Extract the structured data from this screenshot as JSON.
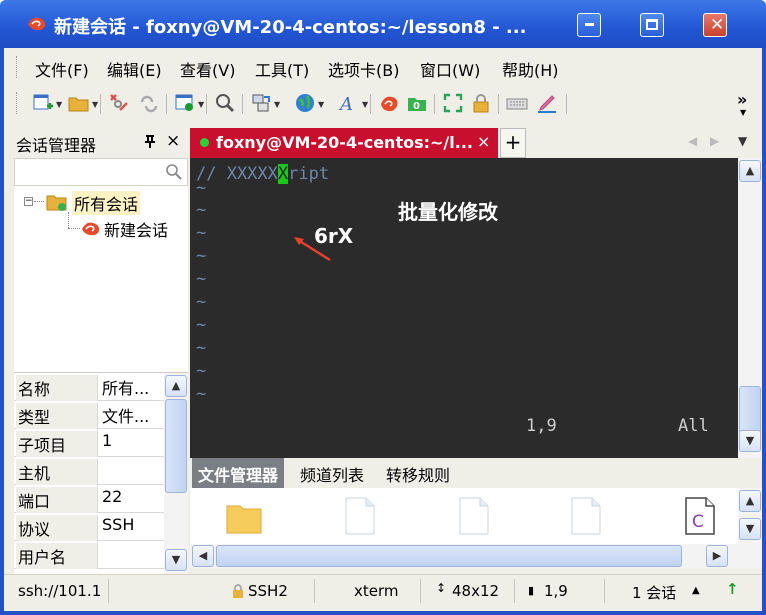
{
  "window": {
    "title": "新建会话 - foxny@VM-20-4-centos:~/lesson8 - ..."
  },
  "menu": [
    "文件(F)",
    "编辑(E)",
    "查看(V)",
    "工具(T)",
    "选项卡(B)",
    "窗口(W)",
    "帮助(H)"
  ],
  "toolbar": {
    "icons": [
      "new-session-icon",
      "open-folder-icon",
      "disconnect-icon",
      "reconnect-icon",
      "new-window-icon",
      "find-icon",
      "transfer-icon",
      "globe-icon",
      "font-icon",
      "xshell-icon",
      "xftp-icon",
      "fullscreen-icon",
      "lock-icon",
      "keyboard-icon",
      "pen-icon"
    ],
    "overflow": "»"
  },
  "session_manager": {
    "title": "会话管理器",
    "pin_glyph": "ᛒ",
    "close_glyph": "×",
    "tree": {
      "root_label": "所有会话",
      "child_label": "新建会话"
    },
    "properties": [
      {
        "key": "名称",
        "value": "所有..."
      },
      {
        "key": "类型",
        "value": "文件..."
      },
      {
        "key": "子项目",
        "value": "1"
      },
      {
        "key": "主机",
        "value": ""
      },
      {
        "key": "端口",
        "value": "22"
      },
      {
        "key": "协议",
        "value": "SSH"
      },
      {
        "key": "用户名",
        "value": ""
      }
    ]
  },
  "tabs": {
    "active_label": "foxny@VM-20-4-centos:~/l...",
    "close_glyph": "×",
    "add_glyph": "+"
  },
  "terminal": {
    "line1_prefix": "// XXXXX",
    "line1_cursor": "X",
    "line1_suffix": "ript",
    "tilde": "~",
    "tilde_count": 10,
    "status_position": "1,9",
    "status_all": "All"
  },
  "annotations": {
    "batch_edit": "批量化修改",
    "command": "6rX"
  },
  "bottom_tabs": [
    "文件管理器",
    "频道列表",
    "转移规则"
  ],
  "status_bar": {
    "address": "ssh://101.1",
    "protocol": "SSH2",
    "terminal_type": "xterm",
    "size": "48x12",
    "position": "1,9",
    "sessions": "1 会话"
  },
  "colors": {
    "title_bar": "#2356d4",
    "active_tab": "#c8102e",
    "terminal_bg": "#2b2b2b",
    "comment_text": "#6d86a8",
    "cursor": "#19c819"
  }
}
